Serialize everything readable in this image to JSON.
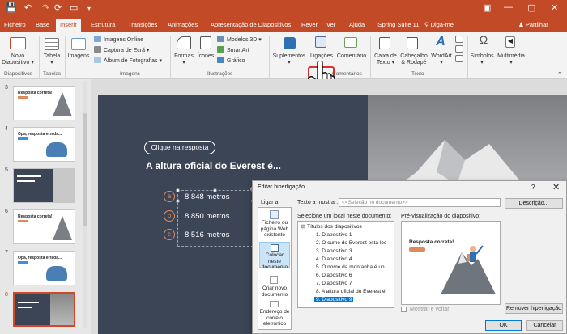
{
  "titlebar": {
    "qa_icons": [
      "save-icon",
      "undo-icon",
      "redo-icon",
      "slideshow-icon",
      "more-icon"
    ],
    "window_buttons": [
      "ribbon-display-icon",
      "minimize-icon",
      "maximize-icon",
      "close-icon"
    ]
  },
  "tabs": [
    "Ficheiro",
    "Base",
    "Inserir",
    "Estrutura",
    "Transições",
    "Animações",
    "Apresentação de Diapositivos",
    "Rever",
    "Ver",
    "Ajuda",
    "iSpring Suite 11"
  ],
  "tell_me": "Diga-me",
  "share": "Partilhar",
  "ribbon": {
    "novo": "Novo",
    "diapositivo": "Diapositivo",
    "tabela": "Tabela",
    "imagens": "Imagens",
    "imagens_online": "Imagens Online",
    "captura": "Captura de Ecrã",
    "album": "Álbum de Fotografias",
    "formas": "Formas",
    "icones": "Ícones",
    "modelos": "Modelos 3D",
    "smartart": "SmartArt",
    "grafico": "Gráfico",
    "suplementos": "Suplementos",
    "ligacoes": "Ligações",
    "comentario": "Comentário",
    "caixa": "Caixa de",
    "texto": "Texto",
    "cabecalho": "Cabeçalho",
    "rodape": "& Rodapé",
    "wordart": "WordArt",
    "simbolos": "Símbolos",
    "multimedia": "Multimédia",
    "groups": {
      "diapositivos": "Diapositivos",
      "tabelas": "Tabelas",
      "imagens": "Imagens",
      "ilustracoes": "Ilustrações",
      "comentarios": "Comentários",
      "texto": "Texto"
    }
  },
  "thumbs": [
    {
      "num": "3",
      "title": "Resposta correta!"
    },
    {
      "num": "4",
      "title": "Opa, resposta errada..."
    },
    {
      "num": "5",
      "title": ""
    },
    {
      "num": "6",
      "title": "Resposta correta!"
    },
    {
      "num": "7",
      "title": "Opa, resposta errada..."
    },
    {
      "num": "8",
      "title": ""
    }
  ],
  "slide": {
    "pill": "Clique na resposta",
    "question": "A altura oficial do Everest é...",
    "options": [
      {
        "letter": "a",
        "text": "8.848 metros"
      },
      {
        "letter": "b",
        "text": "8.850 metros"
      },
      {
        "letter": "c",
        "text": "8.516 metros"
      }
    ]
  },
  "dialog": {
    "title": "Editar hiperligação",
    "help": "?",
    "close": "✕",
    "ligar_a": "Ligar a:",
    "texto_mostrar": "Texto a mostrar:",
    "texto_valor": "<<Seleção no documento>>",
    "descricao": "Descrição...",
    "link_types": [
      "Ficheiro ou página Web existente",
      "Colocar neste documento",
      "Criar novo documento",
      "Endereço de correio eletrónico"
    ],
    "local_label": "Selecione um local neste documento:",
    "tree_root": "Títulos dos diapositivos",
    "tree_items": [
      "1. Diapositivo 1",
      "2. O cume do Everest está loc",
      "3. Diapositivo 3",
      "4. Diapositivo 4",
      "5. O nome da montanha é un",
      "6. Diapositivo 6",
      "7. Diapositivo 7",
      "8. A altura oficial do Everest é",
      "9. Diapositivo 9"
    ],
    "preview_label": "Pré-visualização do diapositivo:",
    "preview_title": "Resposta correta!",
    "mostrar_voltar": "Mostrar e voltar",
    "remover": "Remover hiperligação",
    "ok": "OK",
    "cancelar": "Cancelar"
  },
  "colors": {
    "accent": "#c24a26",
    "slide_bg": "#3b4556",
    "option": "#e08a5c",
    "highlight": "#e0302a"
  }
}
